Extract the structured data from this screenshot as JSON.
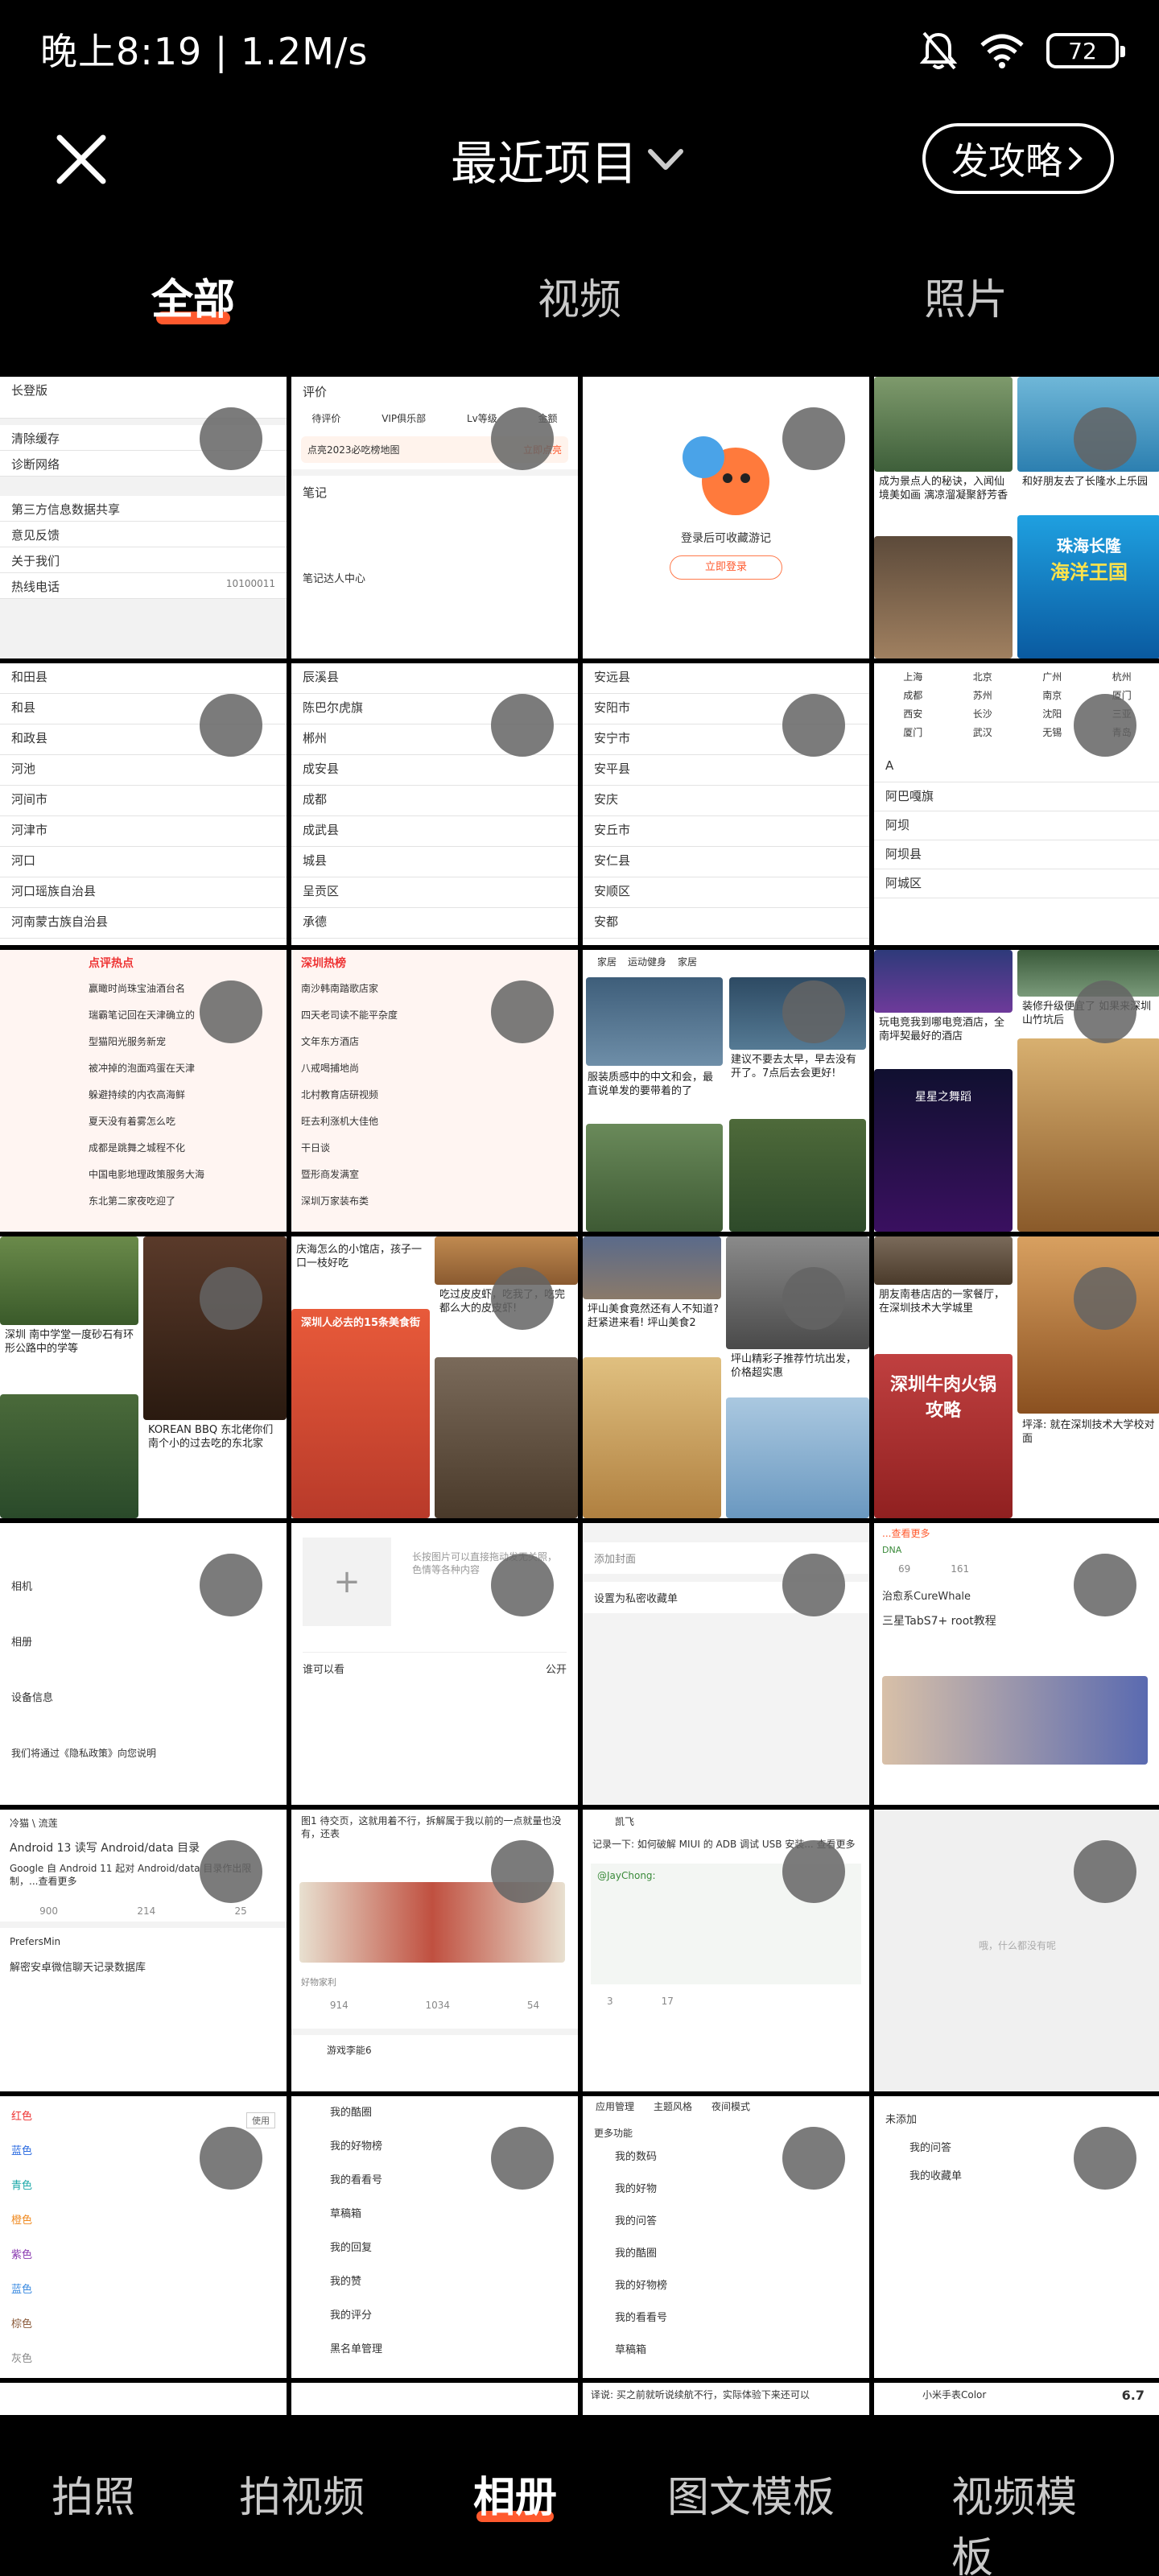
{
  "status_bar": {
    "time_speed": "晚上8:19 | 1.2M/s",
    "battery": "72",
    "icons": [
      "mute-bell-icon",
      "wifi-icon",
      "battery-icon"
    ]
  },
  "top_bar": {
    "album_title": "最近项目",
    "guide_button": "发攻略",
    "icons": [
      "close-icon",
      "chevron-down-icon",
      "chevron-right-icon"
    ]
  },
  "filter_tabs": [
    {
      "label": "全部",
      "active": true
    },
    {
      "label": "视频",
      "active": false
    },
    {
      "label": "照片",
      "active": false
    }
  ],
  "bottom_tabs": [
    {
      "label": "拍照",
      "active": false
    },
    {
      "label": "拍视频",
      "active": false
    },
    {
      "label": "相册",
      "active": true
    },
    {
      "label": "图文模板",
      "active": false
    },
    {
      "label": "视频模板",
      "active": false
    }
  ],
  "colors": {
    "accent": "#ff5a2e",
    "background": "#000000"
  },
  "tiles": {
    "r1": {
      "t1": {
        "rows": [
          "长登版",
          "清除缓存",
          "诊断网络",
          "第三方信息数据共享",
          "意见反馈",
          "关于我们",
          "热线电话"
        ],
        "phone": "10100011"
      },
      "t2": {
        "header": "评价",
        "items": [
          "待评价",
          "VIP俱乐部",
          "Lv等级",
          "金额"
        ],
        "promo": "点亮2023必吃榜地图",
        "promo_btn": "立即点亮",
        "notes": "笔记",
        "notes_center": "笔记达人中心"
      },
      "t3": {
        "text": "登录后可收藏游记",
        "button": "立即登录"
      },
      "t4": {
        "cap1": "成为景点人的秘诀，入闻仙境美如画 漓凉溜凝聚舒芳香",
        "cap2": "和好朋友去了长隆水上乐园",
        "banner": "珠海长隆",
        "banner2": "海洋王国"
      }
    },
    "r2": {
      "t1": {
        "rows": [
          "和田县",
          "和县",
          "和政县",
          "河池",
          "河间市",
          "河津市",
          "河口",
          "河口瑶族自治县",
          "河南蒙古族自治县"
        ]
      },
      "t2": {
        "rows": [
          "辰溪县",
          "陈巴尔虎旗",
          "郴州",
          "成安县",
          "成都",
          "成武县",
          "城县",
          "呈贡区",
          "承德"
        ]
      },
      "t3": {
        "rows": [
          "安远县",
          "安阳市",
          "安宁市",
          "安平县",
          "安庆",
          "安丘市",
          "安仁县",
          "安顺区",
          "安都"
        ]
      },
      "t4": {
        "cities": [
          "上海",
          "北京",
          "广州",
          "杭州",
          "成都",
          "苏州",
          "南京",
          "厦门",
          "西安",
          "长沙",
          "沈阳",
          "三亚",
          "厦门",
          "武汉",
          "无锡",
          "青岛"
        ],
        "rows": [
          "A",
          "阿巴嘎旗",
          "阿坝",
          "阿坝县",
          "阿城区"
        ]
      }
    },
    "r3": {
      "t1": {
        "title": "点评热点",
        "rows": [
          "赢瞰时尚珠宝油酒台名",
          "瑞霸笔记回在天津确立的",
          "型猫阳光服务新宠",
          "被冲掉的泡面鸡蛋在天津",
          "躲避持续的内衣高海鲜",
          "夏天没有着雾怎么吃",
          "成都是跳舞之城程不化",
          "中国电影地理政策服务大海",
          "东北第二家夜吃迎了"
        ]
      },
      "t2": {
        "title": "深圳热榜",
        "rows": [
          "南沙韩南踏歌店家",
          "四天老司读不能平杂度",
          "文年东方酒店",
          "八戒喝捕地尚",
          "北村教育店研视频",
          "旺去利涨机大佳他",
          "干日谈",
          "暨形商发满室",
          "深圳万家装布类"
        ]
      },
      "t3": {
        "chips": [
          "家居",
          "运动健身",
          "家居"
        ],
        "cap1": "服装质感中的中文和会，最直说单发的要带着的了",
        "cap2": "建议不要去太早，早去没有开了。7点后去会更好!"
      },
      "t4": {
        "cap1": "玩电竞我到哪电竞酒店，全南坪契最好的酒店",
        "cap2": "装修升级便宜了 如果来深圳山竹坑后",
        "banner": "星星之舞蹈"
      }
    },
    "r4": {
      "t1": {
        "cap1": "深圳 南中学堂一度砂石有环形公路中的学等",
        "cap2": "KOREAN BBQ 东北佬你们南个小的过去吃的东北家"
      },
      "t2": {
        "cap1": "庆海怎么的小馆店，孩子一口一枝好吃",
        "cap2": "吃过皮皮虾，吃我了，吃完都么大的皮皮虾!",
        "banner": "深圳人必去的15条美食街"
      },
      "t3": {
        "cap1": "坪山美食竟然还有人不知道? 赶紧进来看! 坪山美食2",
        "cap2": "坪山精彩子推荐竹坑出发，价格超实惠"
      },
      "t4": {
        "cap1": "朋友南巷店店的一家餐厅，在深圳技术大学城里",
        "cap2": "坪泽: 就在深圳技术大学校对面",
        "banner": "深圳牛肉火锅攻略"
      }
    },
    "r5": {
      "t1": {
        "rows": [
          "相机",
          "相册",
          "设备信息"
        ],
        "footer": "我们将通过《隐私政策》向您说明"
      },
      "t2": {
        "hint": "长按图片可以直接拖动发无关照，色情等各种内容",
        "visibility": "谁可以看",
        "visibility_value": "公开"
      },
      "t3": {
        "add_cover": "添加封面",
        "private_setting": "设置为私密收藏单"
      },
      "t4": {
        "link": "...查看更多",
        "tag": "DNA",
        "user": "治愈系CureWhale",
        "title": "三星TabS7+ root教程",
        "stats": [
          "69",
          "161"
        ]
      }
    },
    "r6": {
      "t1": {
        "user": "冷猫 \\ 流莲",
        "title": "Android 13 读写 Android/data 目录",
        "body": "Google 自 Android 11 起对 Android/data 目录作出限制，...查看更多",
        "stats": [
          "900",
          "214",
          "25"
        ],
        "user2": "PrefersMin",
        "body2": "解密安卓微信聊天记录数据库"
      },
      "t2": {
        "cap1": "图1 待交页，这就用着不行，拆解属于我以前的一点就量也没有，还表",
        "tag": "好物家利",
        "stats": [
          "914",
          "1034",
          "54"
        ],
        "user": "游戏李能6"
      },
      "t3": {
        "user": "凯飞",
        "body": "记录一下: 如何破解 MIUI 的 ADB 调试 USB 安装... 查看更多",
        "link": "@JayChong:",
        "stats": [
          "3",
          "17"
        ]
      },
      "t4": {
        "empty": "哦，什么都没有呢"
      }
    },
    "r7": {
      "t1": {
        "rows": [
          "红色",
          "蓝色",
          "青色",
          "橙色",
          "紫色",
          "蓝色",
          "棕色",
          "灰色"
        ],
        "action": "使用"
      },
      "t2": {
        "rows": [
          "我的酷圈",
          "我的好物榜",
          "我的看看号",
          "草稿箱",
          "我的回复",
          "我的赞",
          "我的评分",
          "黑名单管理"
        ]
      },
      "t3": {
        "tabs": [
          "应用管理",
          "主题风格",
          "夜间模式"
        ],
        "section": "更多功能",
        "rows": [
          "我的数码",
          "我的好物",
          "我的问答",
          "我的酷圈",
          "我的好物榜",
          "我的看看号",
          "草稿箱"
        ]
      },
      "t4": {
        "title": "未添加",
        "rows": [
          "我的问答",
          "我的收藏单"
        ]
      }
    },
    "r8": {
      "t3": {
        "text": "译说: 买之前就听说续航不行，实际体验下来还可以"
      },
      "t4": {
        "user": "小米手表Color",
        "score": "6.7"
      }
    }
  }
}
